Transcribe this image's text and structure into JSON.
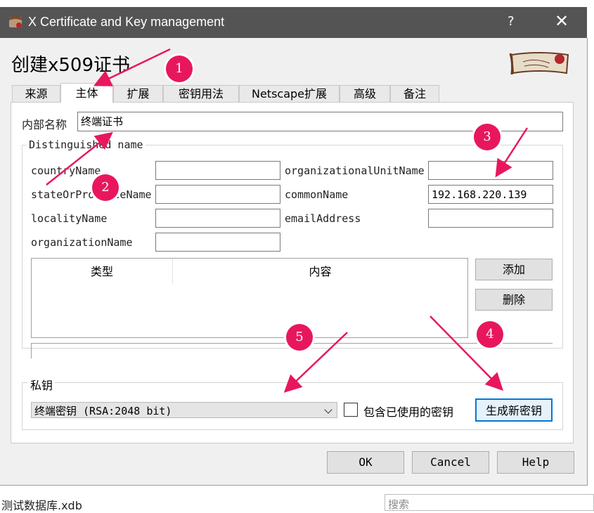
{
  "window": {
    "title": "X Certificate and Key management",
    "help_label": "?",
    "close_label": "✕"
  },
  "heading": "创建x509证书",
  "tabs": [
    {
      "label": "来源"
    },
    {
      "label": "主体"
    },
    {
      "label": "扩展"
    },
    {
      "label": "密钥用法"
    },
    {
      "label": "Netscape扩展"
    },
    {
      "label": "高级"
    },
    {
      "label": "备注"
    }
  ],
  "subject": {
    "internal_name_label": "内部名称",
    "internal_name_value": "终端证书",
    "dn_group_label": "Distinguished name",
    "fields": {
      "countryName": {
        "label": "countryName",
        "value": ""
      },
      "stateOrProvinceName": {
        "label": "stateOrProvinceName",
        "value": ""
      },
      "localityName": {
        "label": "localityName",
        "value": ""
      },
      "organizationName": {
        "label": "organizationName",
        "value": ""
      },
      "organizationalUnitName": {
        "label": "organizationalUnitName",
        "value": ""
      },
      "commonName": {
        "label": "commonName",
        "value": "192.168.220.139"
      },
      "emailAddress": {
        "label": "emailAddress",
        "value": ""
      }
    },
    "table": {
      "columns": [
        "类型",
        "内容"
      ]
    },
    "add_label": "添加",
    "delete_label": "删除"
  },
  "private_key": {
    "group_label": "私钥",
    "selected": "终端密钥 (RSA:2048 bit)",
    "include_used_label": "包含已使用的密钥",
    "include_used_checked": false,
    "generate_label": "生成新密钥"
  },
  "buttons": {
    "ok": "OK",
    "cancel": "Cancel",
    "help": "Help"
  },
  "annotations": [
    "1",
    "2",
    "3",
    "4",
    "5"
  ],
  "background": {
    "left_text": "测试数据库.xdb",
    "search_placeholder": "搜索"
  },
  "colors": {
    "annotation": "#e8175d",
    "titlebar": "#545454",
    "primary_button_border": "#0078d7"
  }
}
